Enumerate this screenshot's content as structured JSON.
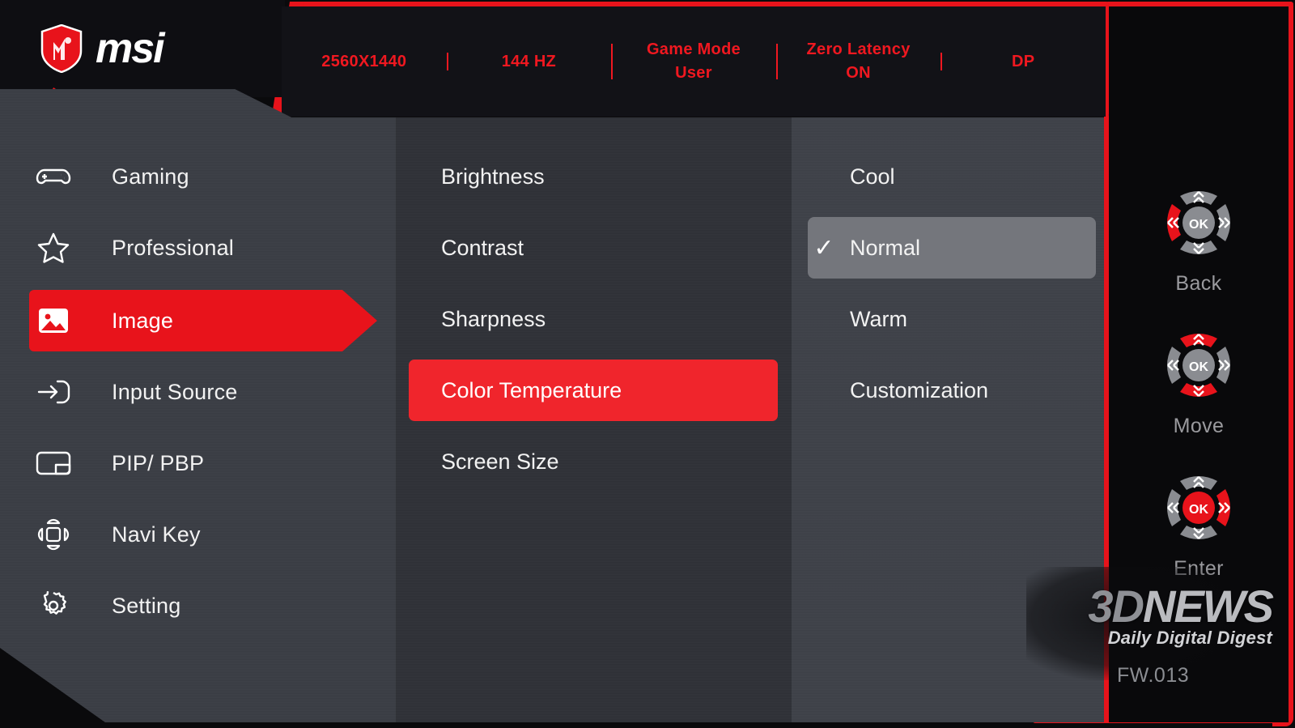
{
  "brand": {
    "name": "msi",
    "logo_icon": "msi-dragon-shield-icon"
  },
  "status_bar": {
    "items": [
      {
        "line1": "2560X1440",
        "line2": ""
      },
      {
        "line1": "144 HZ",
        "line2": ""
      },
      {
        "line1": "Game Mode",
        "line2": "User"
      },
      {
        "line1": "Zero Latency",
        "line2": "ON"
      },
      {
        "line1": "DP",
        "line2": ""
      }
    ]
  },
  "sidebar": {
    "items": [
      {
        "label": "Gaming",
        "icon": "gamepad-icon",
        "active": false
      },
      {
        "label": "Professional",
        "icon": "star-icon",
        "active": false
      },
      {
        "label": "Image",
        "icon": "picture-icon",
        "active": true
      },
      {
        "label": "Input Source",
        "icon": "input-arrow-icon",
        "active": false
      },
      {
        "label": "PIP/ PBP",
        "icon": "pip-window-icon",
        "active": false
      },
      {
        "label": "Navi Key",
        "icon": "navi-dpad-icon",
        "active": false
      },
      {
        "label": "Setting",
        "icon": "gear-icon",
        "active": false
      }
    ]
  },
  "submenu": {
    "items": [
      {
        "label": "Brightness",
        "active": false
      },
      {
        "label": "Contrast",
        "active": false
      },
      {
        "label": "Sharpness",
        "active": false
      },
      {
        "label": "Color Temperature",
        "active": true
      },
      {
        "label": "Screen Size",
        "active": false
      }
    ]
  },
  "options": {
    "items": [
      {
        "label": "Cool",
        "selected": false,
        "check": ""
      },
      {
        "label": "Normal",
        "selected": true,
        "check": "✓"
      },
      {
        "label": "Warm",
        "selected": false,
        "check": ""
      },
      {
        "label": "Customization",
        "selected": false,
        "check": ""
      }
    ]
  },
  "nav_hints": {
    "items": [
      {
        "label": "Back",
        "center": "OK",
        "highlight": "left"
      },
      {
        "label": "Move",
        "center": "OK",
        "highlight": "up-down"
      },
      {
        "label": "Enter",
        "center": "OK",
        "highlight": "center-right"
      }
    ]
  },
  "watermark": {
    "line1_a": "3D",
    "line1_b": "NEWS",
    "line2": "Daily Digital Digest"
  },
  "firmware": {
    "version": "FW.013"
  },
  "colors": {
    "accent_red": "#e8131b",
    "highlight_red": "#f0252c",
    "panel": "#3a3d44",
    "panel_mid": "#2f3137",
    "panel_right": "#3e4148",
    "select_gray": "#74767c"
  }
}
